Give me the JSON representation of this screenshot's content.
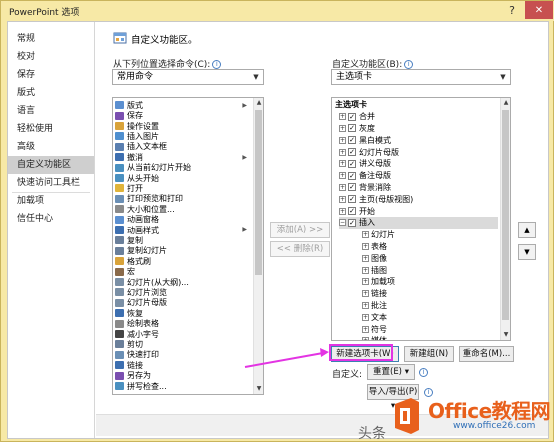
{
  "window": {
    "title": "PowerPoint 选项",
    "help_glyph": "?",
    "close_glyph": "✕"
  },
  "nav": {
    "items": [
      {
        "label": "常规",
        "selected": false
      },
      {
        "label": "校对",
        "selected": false
      },
      {
        "label": "保存",
        "selected": false
      },
      {
        "label": "版式",
        "selected": false
      },
      {
        "label": "语言",
        "selected": false
      },
      {
        "label": "轻松使用",
        "selected": false
      },
      {
        "label": "高级",
        "selected": false
      },
      {
        "label": "自定义功能区",
        "selected": true
      },
      {
        "label": "快速访问工具栏",
        "selected": false
      },
      {
        "label": "加载项",
        "selected": false
      },
      {
        "label": "信任中心",
        "selected": false
      }
    ]
  },
  "header": {
    "title": "自定义功能区。"
  },
  "left_panel": {
    "label": "从下列位置选择命令(C):",
    "combo_value": "常用命令",
    "commands": [
      {
        "label": "版式",
        "icon": "layout-icon",
        "color": "#5b8fd0",
        "has_submenu": true
      },
      {
        "label": "保存",
        "icon": "save-icon",
        "color": "#7a4fb0",
        "has_submenu": false
      },
      {
        "label": "操作设置",
        "icon": "action-settings-icon",
        "color": "#d9a33a",
        "has_submenu": false
      },
      {
        "label": "插入图片",
        "icon": "insert-picture-icon",
        "color": "#4f8fcf",
        "has_submenu": false
      },
      {
        "label": "插入文本框",
        "icon": "insert-textbox-icon",
        "color": "#5a7fb0",
        "has_submenu": false
      },
      {
        "label": "撤消",
        "icon": "undo-icon",
        "color": "#3d6fb0",
        "has_submenu": true
      },
      {
        "label": "从当前幻灯片开始",
        "icon": "slideshow-current-icon",
        "color": "#4a90c0",
        "has_submenu": false
      },
      {
        "label": "从头开始",
        "icon": "slideshow-start-icon",
        "color": "#4a90c0",
        "has_submenu": false
      },
      {
        "label": "打开",
        "icon": "open-icon",
        "color": "#e0b43a",
        "has_submenu": false
      },
      {
        "label": "打印预览和打印",
        "icon": "print-preview-icon",
        "color": "#6a8fb5",
        "has_submenu": false
      },
      {
        "label": "大小和位置...",
        "icon": "size-position-icon",
        "color": "#8a8a8a",
        "has_submenu": false
      },
      {
        "label": "动画窗格",
        "icon": "animation-pane-icon",
        "color": "#5b8fd0",
        "has_submenu": false
      },
      {
        "label": "动画样式",
        "icon": "animation-styles-icon",
        "color": "#3d6fb0",
        "has_submenu": true
      },
      {
        "label": "复制",
        "icon": "copy-icon",
        "color": "#6a7f9a",
        "has_submenu": false
      },
      {
        "label": "复制幻灯片",
        "icon": "duplicate-slide-icon",
        "color": "#6a7f9a",
        "has_submenu": false
      },
      {
        "label": "格式刷",
        "icon": "format-painter-icon",
        "color": "#d9a33a",
        "has_submenu": false
      },
      {
        "label": "宏",
        "icon": "macro-icon",
        "color": "#8a6a4a",
        "has_submenu": false
      },
      {
        "label": "幻灯片(从大纲)...",
        "icon": "slides-from-outline-icon",
        "color": "#7a8fa5",
        "has_submenu": false
      },
      {
        "label": "幻灯片浏览",
        "icon": "slide-sorter-icon",
        "color": "#7a8fa5",
        "has_submenu": false
      },
      {
        "label": "幻灯片母版",
        "icon": "slide-master-icon",
        "color": "#7a8fa5",
        "has_submenu": false
      },
      {
        "label": "恢复",
        "icon": "redo-icon",
        "color": "#3d6fb0",
        "has_submenu": false
      },
      {
        "label": "绘制表格",
        "icon": "draw-table-icon",
        "color": "#8a8a8a",
        "has_submenu": false
      },
      {
        "label": "减小字号",
        "icon": "decrease-font-icon",
        "color": "#444444",
        "has_submenu": false
      },
      {
        "label": "剪切",
        "icon": "cut-icon",
        "color": "#6a7f9a",
        "has_submenu": false
      },
      {
        "label": "快速打印",
        "icon": "quick-print-icon",
        "color": "#6a8fb5",
        "has_submenu": false
      },
      {
        "label": "链接",
        "icon": "link-icon",
        "color": "#3d6fb0",
        "has_submenu": false
      },
      {
        "label": "另存为",
        "icon": "save-as-icon",
        "color": "#7a4fb0",
        "has_submenu": false
      },
      {
        "label": "拼写检查...",
        "icon": "spelling-icon",
        "color": "#4a90c0",
        "has_submenu": false
      }
    ]
  },
  "middle": {
    "add_label": "添加(A) >>",
    "remove_label": "<< 删除(R)"
  },
  "right_panel": {
    "label": "自定义功能区(B):",
    "combo_value": "主选项卡",
    "tree": [
      {
        "label": "主选项卡",
        "level": 0,
        "expander": "",
        "checked": null
      },
      {
        "label": "合并",
        "level": 1,
        "expander": "+",
        "checked": true
      },
      {
        "label": "灰度",
        "level": 1,
        "expander": "+",
        "checked": true
      },
      {
        "label": "黑白模式",
        "level": 1,
        "expander": "+",
        "checked": true
      },
      {
        "label": "幻灯片母版",
        "level": 1,
        "expander": "+",
        "checked": true
      },
      {
        "label": "讲义母版",
        "level": 1,
        "expander": "+",
        "checked": true
      },
      {
        "label": "备注母版",
        "level": 1,
        "expander": "+",
        "checked": true
      },
      {
        "label": "背景消除",
        "level": 1,
        "expander": "+",
        "checked": true
      },
      {
        "label": "主页(母版视图)",
        "level": 1,
        "expander": "+",
        "checked": true
      },
      {
        "label": "开始",
        "level": 1,
        "expander": "+",
        "checked": true
      },
      {
        "label": "插入",
        "level": 1,
        "expander": "−",
        "checked": true,
        "selected": true
      },
      {
        "label": "幻灯片",
        "level": 2,
        "expander": "+",
        "checked": null
      },
      {
        "label": "表格",
        "level": 2,
        "expander": "+",
        "checked": null
      },
      {
        "label": "图像",
        "level": 2,
        "expander": "+",
        "checked": null
      },
      {
        "label": "插图",
        "level": 2,
        "expander": "+",
        "checked": null
      },
      {
        "label": "加载项",
        "level": 2,
        "expander": "+",
        "checked": null
      },
      {
        "label": "链接",
        "level": 2,
        "expander": "+",
        "checked": null
      },
      {
        "label": "批注",
        "level": 2,
        "expander": "+",
        "checked": null
      },
      {
        "label": "文本",
        "level": 2,
        "expander": "+",
        "checked": null
      },
      {
        "label": "符号",
        "level": 2,
        "expander": "+",
        "checked": null
      },
      {
        "label": "媒体",
        "level": 2,
        "expander": "+",
        "checked": null
      }
    ],
    "move_up_glyph": "▲",
    "move_down_glyph": "▼",
    "new_tab_label": "新建选项卡(W)",
    "new_group_label": "新建组(N)",
    "rename_label": "重命名(M)...",
    "custom_label": "自定义:",
    "reset_label": "重置(E) ▾",
    "import_export_label": "导入/导出(P) ▾"
  },
  "watermark": {
    "left_text": "头条",
    "brand": "Office教程网",
    "url": "www.office26.com",
    "colors": {
      "brand": "#e8601c",
      "logo": "#e8601c",
      "url": "#2f6fb7"
    }
  },
  "annotation": {
    "color": "#e334e3",
    "arrow_target": "新建选项卡(W)"
  }
}
